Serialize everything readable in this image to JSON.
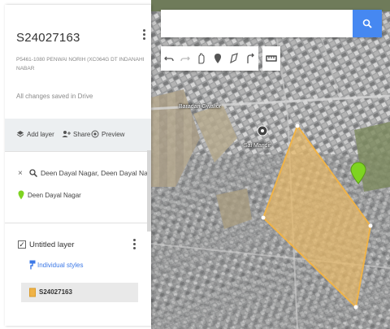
{
  "map": {
    "title": "S24027163",
    "description": "P5461-1080 PENWAI NORIH (XC064G DT INDANAHI NABAR",
    "save_status": "All changes saved in Drive",
    "actions": {
      "add_layer": "Add layer",
      "share": "Share",
      "preview": "Preview"
    }
  },
  "search": {
    "value": "",
    "placeholder": ""
  },
  "search_result": {
    "query": "Deen Dayal Nagar, Deen Dayal Nagar",
    "place": "Deen Dayal Nagar"
  },
  "layer": {
    "title": "Untitled layer",
    "styles_link": "Individual styles",
    "feature": "S24027163",
    "checked": true
  },
  "map_labels": {
    "top_left": "Baradari Gwalior",
    "center": "Sai Mandir"
  },
  "icons": {
    "search": "search-icon",
    "undo": "undo-icon",
    "redo": "redo-icon",
    "hand": "hand-icon",
    "marker": "add-marker-icon",
    "line": "draw-line-icon",
    "route": "add-directions-icon",
    "measure": "ruler-icon"
  },
  "colors": {
    "search_button": "#4688f1",
    "polygon_fill": "#e8b866",
    "polygon_stroke": "#f0b347",
    "green_pin": "#7ed321",
    "link": "#3b78e7"
  }
}
